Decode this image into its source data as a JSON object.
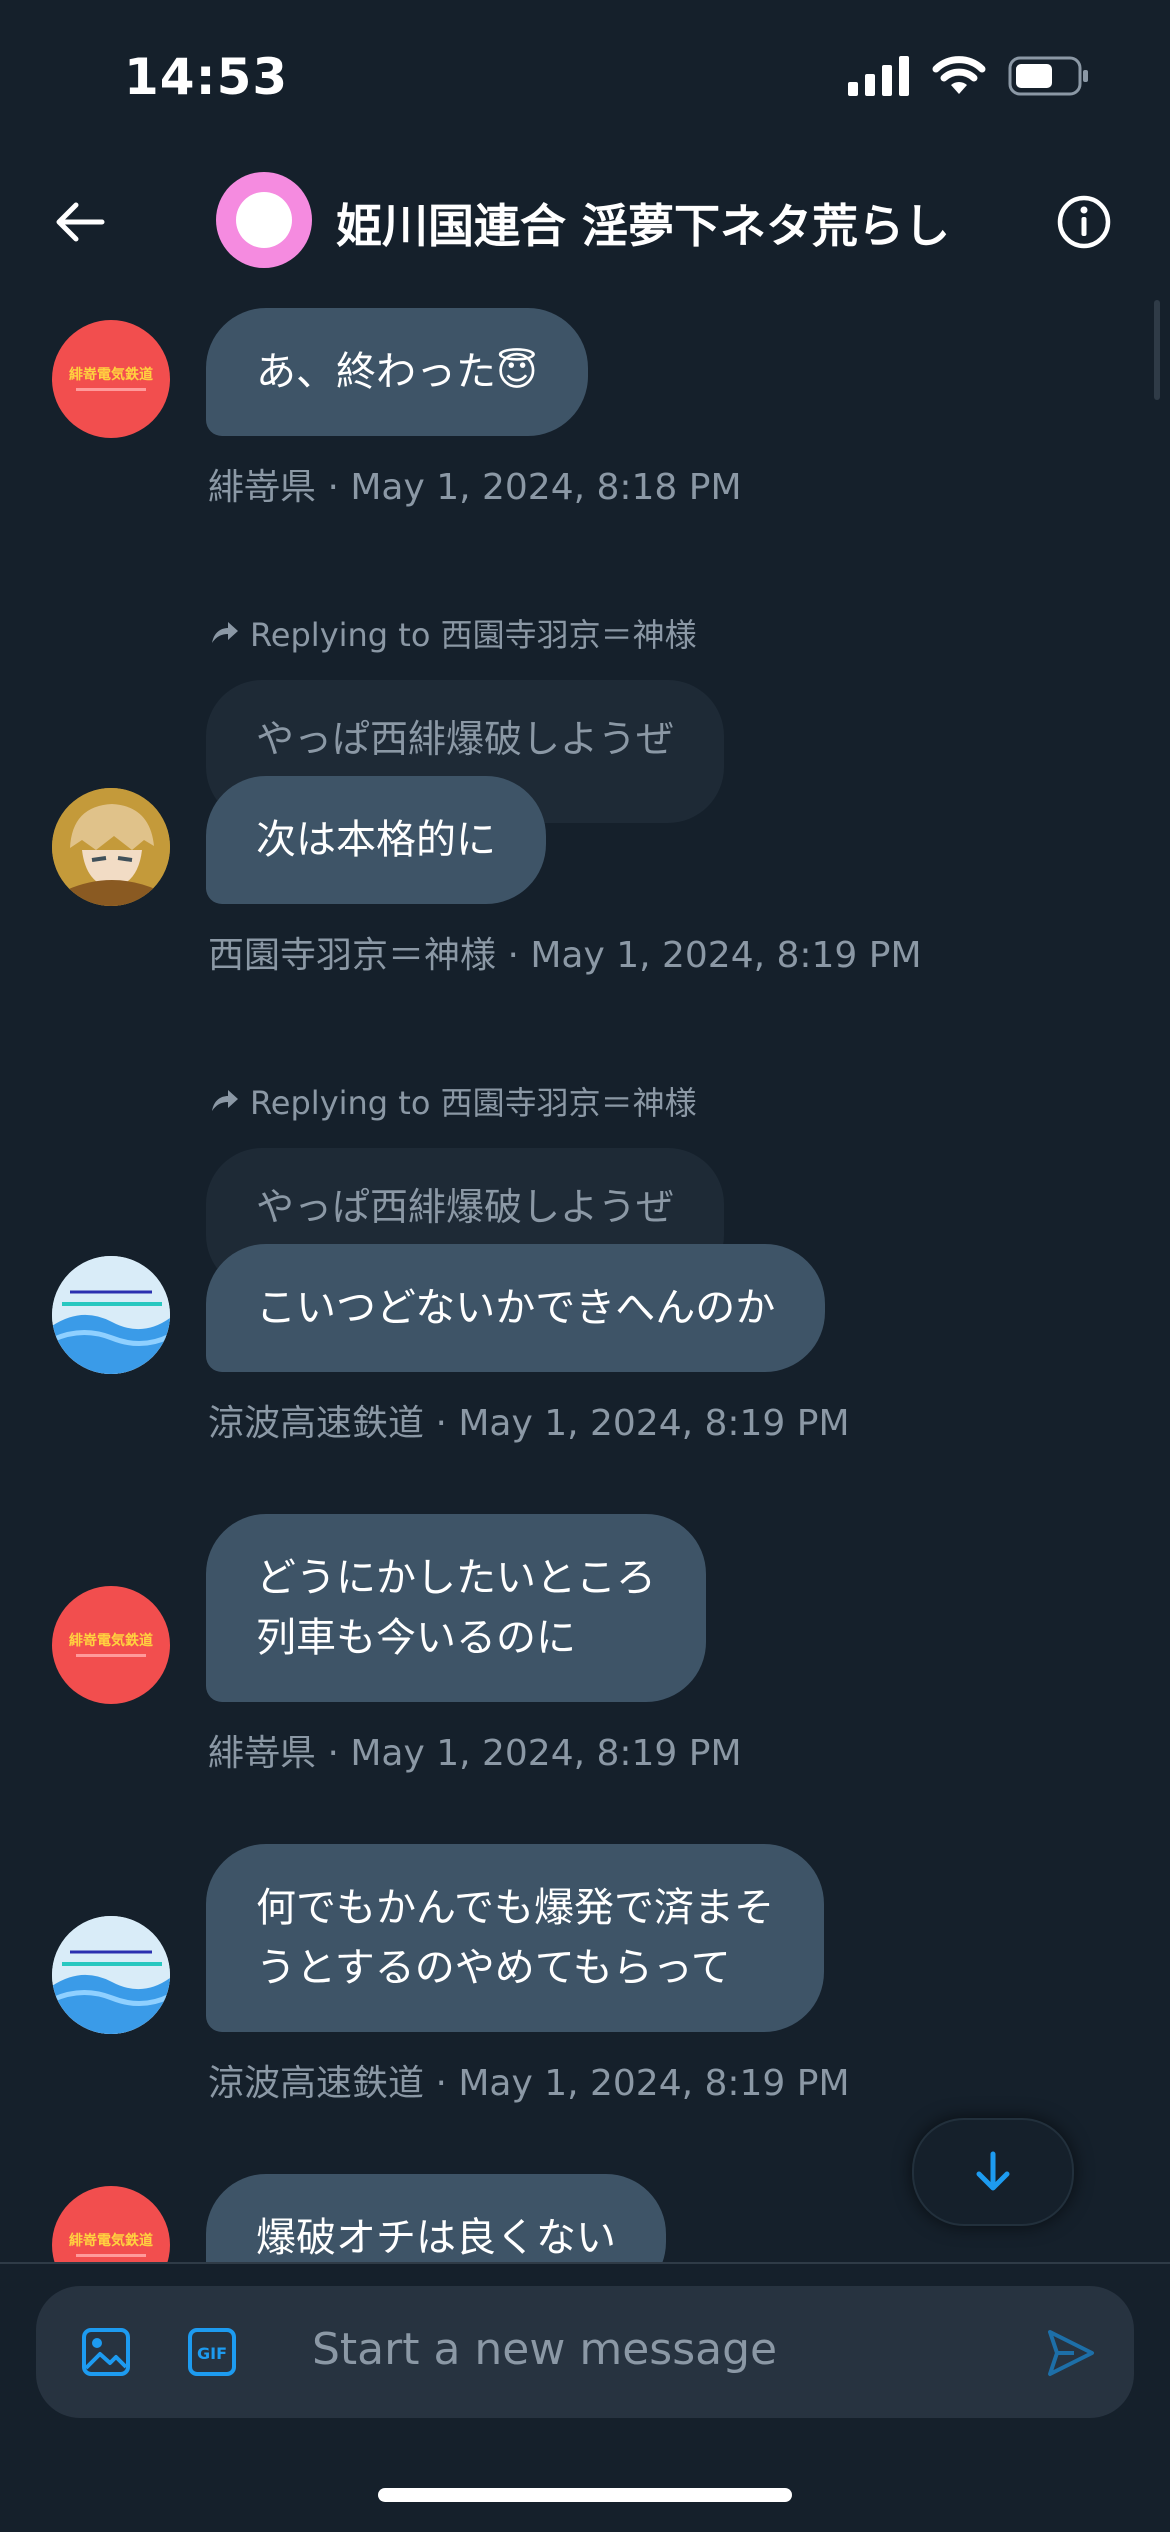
{
  "status_bar": {
    "time": "14:53"
  },
  "header": {
    "title": "姫川国連合 淫夢下ネタ荒らし"
  },
  "messages": [
    {
      "id": "m1",
      "text": "あ、終わった😇",
      "meta": "緋嵜県 · May 1, 2024, 8:18 PM"
    },
    {
      "id": "m2",
      "reply_to": "Replying to 西園寺羽京＝神様",
      "quote": "やっぱ西緋爆破しようぜ",
      "text": "次は本格的に",
      "meta": "西園寺羽京＝神様 · May 1, 2024, 8:19 PM"
    },
    {
      "id": "m3",
      "reply_to": "Replying to 西園寺羽京＝神様",
      "quote": "やっぱ西緋爆破しようぜ",
      "text": "こいつどないかできへんのか",
      "meta": "涼波高速鉄道 · May 1, 2024, 8:19 PM"
    },
    {
      "id": "m4",
      "text_line1": "どうにかしたいところ",
      "text_line2": "列車も今いるのに",
      "meta": "緋嵜県 · May 1, 2024, 8:19 PM"
    },
    {
      "id": "m5",
      "text_line1": "何でもかんでも爆発で済まそ",
      "text_line2": "うとするのやめてもらって",
      "meta": "涼波高速鉄道 · May 1, 2024, 8:19 PM"
    },
    {
      "id": "m6",
      "text": "爆破オチは良くない"
    }
  ],
  "composer": {
    "placeholder": "Start a new message"
  },
  "colors": {
    "background": "#15202b",
    "bubble": "#3e5467",
    "accent": "#1d9bf0",
    "muted": "#8b98a5"
  }
}
